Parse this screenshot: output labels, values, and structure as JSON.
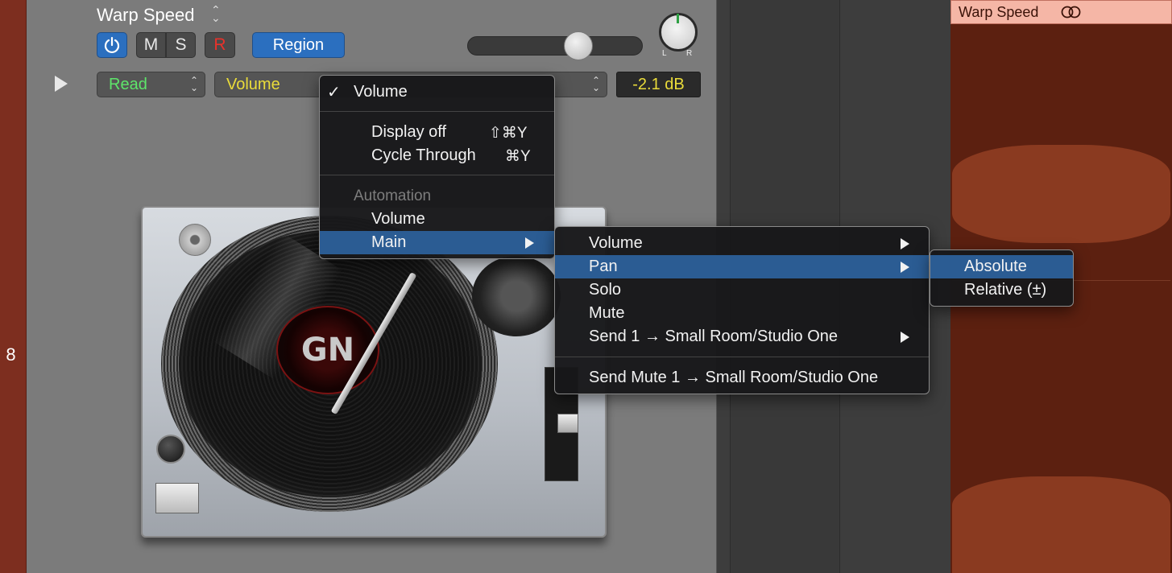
{
  "track": {
    "number": "8",
    "name": "Warp Speed"
  },
  "header": {
    "power_icon": "power-icon",
    "mute_label": "M",
    "solo_label": "S",
    "record_label": "R",
    "region_label": "Region",
    "pan_left": "L",
    "pan_right": "R",
    "automation_mode": "Read",
    "automation_param": "Volume",
    "value_display": "-2.1 dB"
  },
  "colors": {
    "accent_blue": "#2b6fbf",
    "track_color": "#7d2e1f",
    "read_green": "#5ee56a",
    "param_yellow": "#eadc3a",
    "menu_highlight": "#2b5c93",
    "region_header": "#f5b6a6"
  },
  "menu_main": {
    "checked_label": "Volume",
    "check_mark": "✓",
    "display_off_label": "Display off",
    "display_off_shortcut": "⇧⌘Y",
    "cycle_label": "Cycle Through",
    "cycle_shortcut": "⌘Y",
    "section_header": "Automation",
    "volume_label": "Volume",
    "main_label": "Main"
  },
  "menu_sub": {
    "items": [
      "Volume",
      "Pan",
      "Solo",
      "Mute",
      "Send 1 → Small Room/Studio One"
    ],
    "send_mute_label": "Send Mute 1 → Small Room/Studio One"
  },
  "menu_pan": {
    "absolute_label": "Absolute",
    "relative_label": "Relative (±)"
  },
  "region": {
    "title": "Warp Speed",
    "loop_icon": "loop-icon"
  },
  "artwork": {
    "label_text": "GN"
  }
}
